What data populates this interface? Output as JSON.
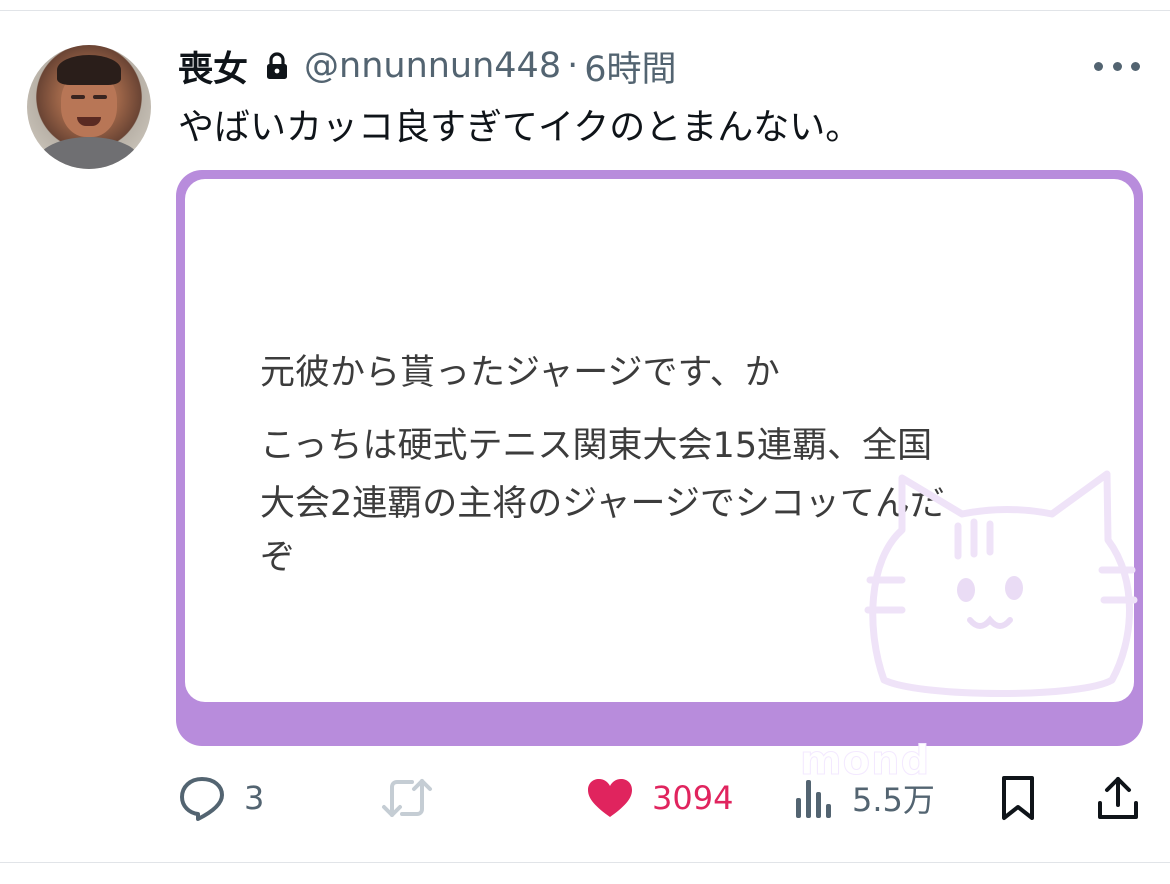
{
  "tweet": {
    "display_name": "喪女",
    "handle": "@nnunnun448",
    "separator": "·",
    "time": "6時間",
    "text": "やばいカッコ良すぎてイクのとまんない。"
  },
  "card": {
    "lines": [
      "元彼から貰ったジャージです、か",
      "こっちは硬式テニス関東大会15連覇、全国",
      "大会2連覇の主将のジャージでシコッてんだ",
      "ぞ"
    ],
    "watermark": "mond",
    "border_color": "#b88cdc"
  },
  "actions": {
    "reply_count": "3",
    "retweet_count": "",
    "like_count": "3094",
    "views_count": "5.5万"
  },
  "icons": {
    "more": "more-icon",
    "lock": "lock-icon",
    "reply": "reply-icon",
    "retweet": "retweet-icon",
    "like": "heart-icon",
    "views": "views-icon",
    "bookmark": "bookmark-icon",
    "share": "share-icon"
  },
  "colors": {
    "like": "#e0245e",
    "secondary_text": "#536471",
    "primary_text": "#0f1419"
  }
}
